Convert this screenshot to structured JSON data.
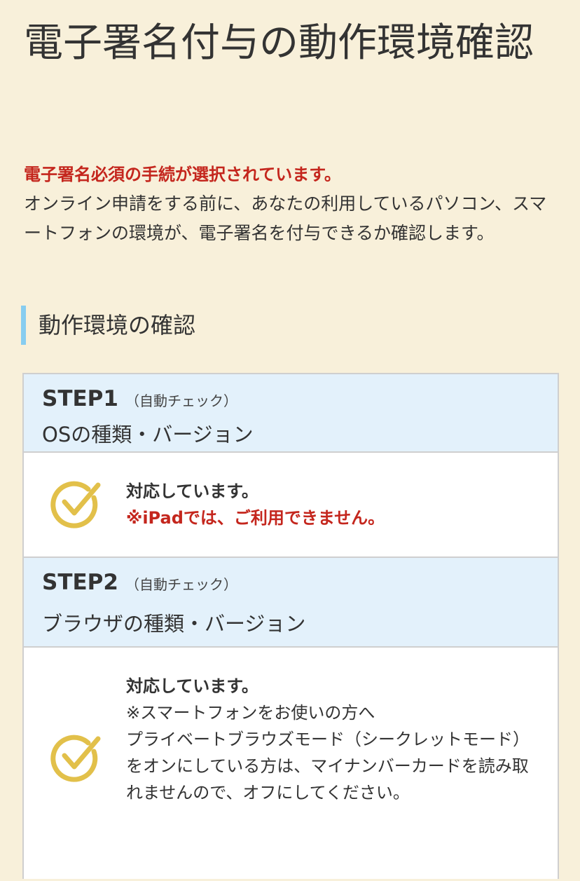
{
  "page": {
    "title": "電子署名付与の動作環境確認"
  },
  "intro": {
    "alert": "電子署名必須の手続が選択されています。",
    "description": "オンライン申請をする前に、あなたの利用しているパソコン、スマートフォンの環境が、電子署名を付与できるか確認します。"
  },
  "section": {
    "heading": "動作環境の確認"
  },
  "steps": [
    {
      "number": "STEP1",
      "mode": "（自動チェック）",
      "target": "OSの種類・バージョン",
      "status": "対応しています。",
      "note_red": "※iPadでは、ご利用できません。",
      "icon": "check-circle-icon"
    },
    {
      "number": "STEP2",
      "mode": "（自動チェック）",
      "target": "ブラウザの種類・バージョン",
      "status": "対応しています。",
      "note": "※スマートフォンをお使いの方へ\nプライベートブラウズモード（シークレットモード）をオンにしている方は、マイナンバーカードを読み取れませんので、オフにしてください。",
      "icon": "check-circle-icon"
    }
  ],
  "colors": {
    "background": "#f8f0da",
    "alert": "#c4261d",
    "step_header": "#e3f1fb",
    "heading_accent": "#87cdf0",
    "check_icon": "#e2c04a"
  }
}
